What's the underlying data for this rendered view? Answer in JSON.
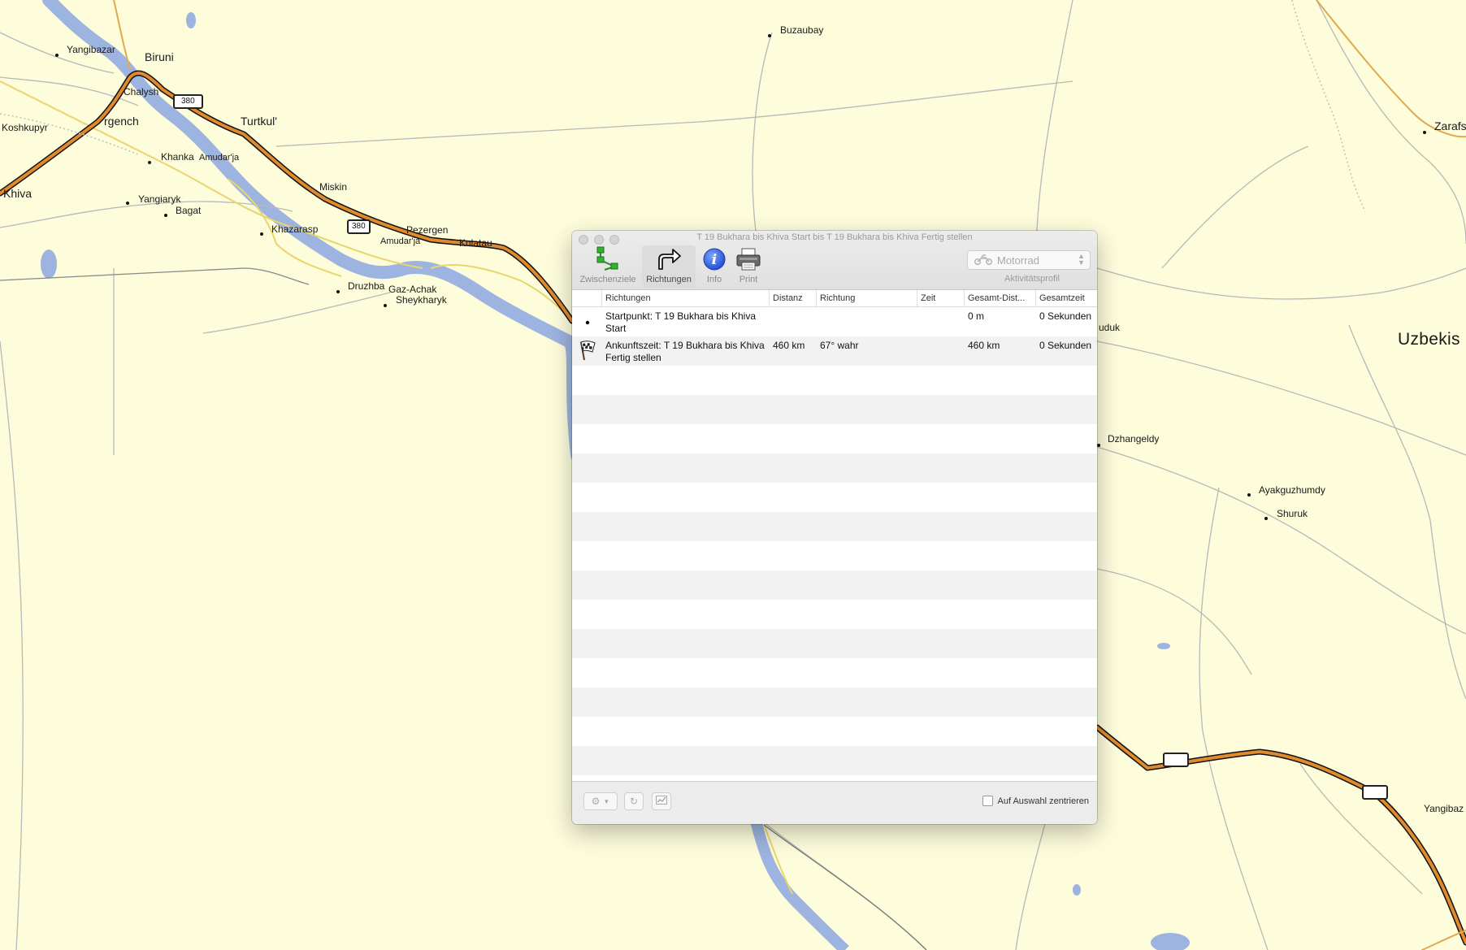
{
  "window": {
    "title": "T 19 Bukhara bis Khiva Start bis T 19 Bukhara bis Khiva Fertig stellen"
  },
  "toolbar": {
    "waypoints_label": "Zwischenziele",
    "directions_label": "Richtungen",
    "info_label": "Info",
    "print_label": "Print",
    "activity_profile_value": "Motorrad",
    "activity_profile_label": "Aktivitätsprofil"
  },
  "table": {
    "columns": [
      "Richtungen",
      "Distanz",
      "Richtung",
      "Zeit",
      "Gesamt-Dist...",
      "Gesamtzeit"
    ],
    "rows": [
      {
        "icon": "start-dot-icon",
        "direction": "Startpunkt: T 19 Bukhara bis Khiva Start",
        "distance": "",
        "heading": "",
        "time": "",
        "total_distance": "0 m",
        "total_time": "0 Sekunden"
      },
      {
        "icon": "checkered-flag-icon",
        "direction": "Ankunftszeit: T 19 Bukhara bis Khiva Fertig stellen",
        "distance": "460 km",
        "heading": "67° wahr",
        "time": "",
        "total_distance": "460 km",
        "total_time": "0 Sekunden"
      }
    ]
  },
  "bottombar": {
    "center_on_selection_label": "Auf Auswahl zentrieren"
  },
  "map": {
    "places": {
      "yangibazar": "Yangibazar",
      "biruni": "Biruni",
      "chalysh": "Chalysh",
      "urgench": "rgench",
      "turtkul": "Turtkul'",
      "koshkupyr": "Koshkupyr",
      "khanka": "Khanka",
      "amudarja1": "Amudar'ja",
      "khiva": "Khiva",
      "yangiaryk": "Yangiaryk",
      "bagat": "Bagat",
      "miskin": "Miskin",
      "khazarasp": "Khazarasp",
      "pezergen": "Pezergen",
      "amudarja2": "Amudar'ja",
      "kulatau": "Kulatau",
      "druzhba": "Druzhba",
      "gazachak": "Gaz-Achak",
      "sheykharyk": "Sheykharyk",
      "buzaubay": "Buzaubay",
      "zarafs": "Zarafs",
      "uzbekis": "Uzbekis",
      "uduk": "uduk",
      "dzhangeldy": "Dzhangeldy",
      "ayakguzhumdy": "Ayakguzhumdy",
      "shuruk": "Shuruk",
      "yangibaz": "Yangibaz"
    },
    "road_shields": {
      "r380a": "380",
      "r380b": "380"
    }
  }
}
